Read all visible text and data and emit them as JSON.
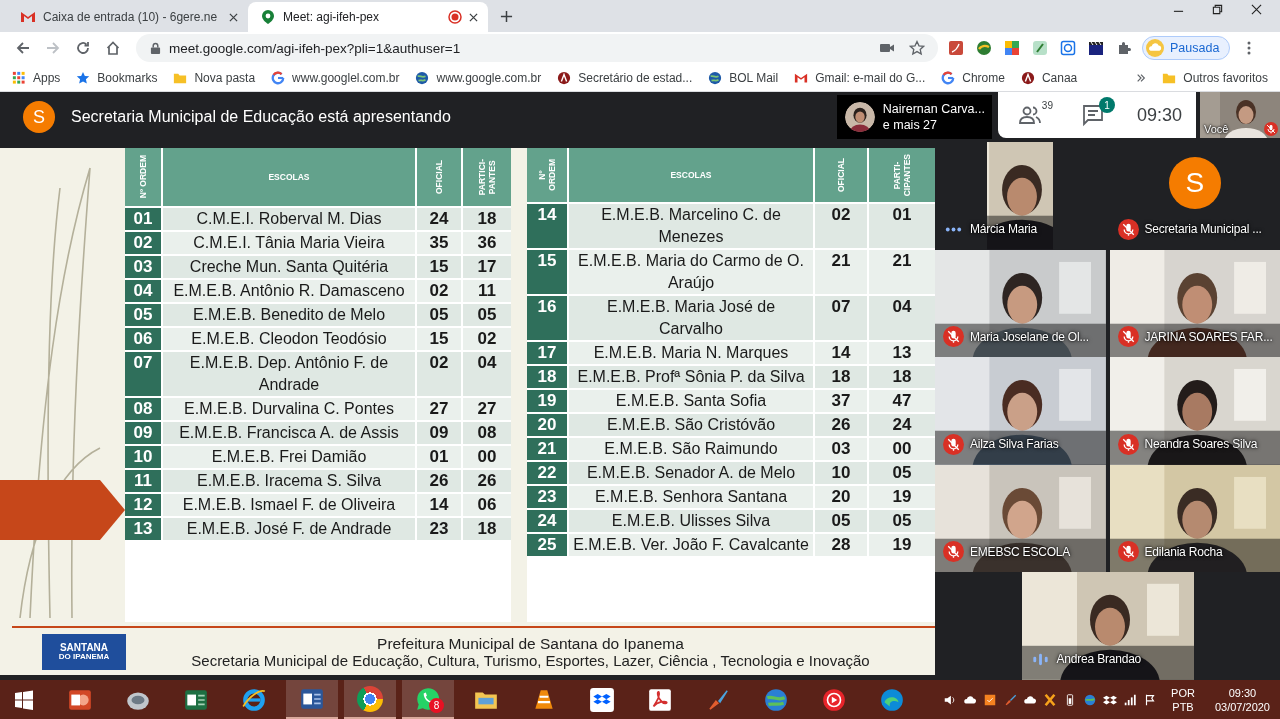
{
  "browser": {
    "tabs": [
      {
        "title": "Caixa de entrada (10) - 6gere.ne",
        "kind": "mail",
        "selected": false,
        "recording": false
      },
      {
        "title": "Meet: agi-ifeh-pex",
        "kind": "meet",
        "selected": true,
        "recording": true
      }
    ],
    "url": "meet.google.com/agi-ifeh-pex?pli=1&authuser=1",
    "profile_label": "Pausada",
    "bookmarks": [
      {
        "label": "Apps",
        "kind": "apps"
      },
      {
        "label": "Bookmarks",
        "kind": "star"
      },
      {
        "label": "Nova pasta",
        "kind": "folder"
      },
      {
        "label": "www.googlel.com.br",
        "kind": "google"
      },
      {
        "label": "www.google.com.br",
        "kind": "globe"
      },
      {
        "label": "Secretário de estad...",
        "kind": "seal"
      },
      {
        "label": "BOL Mail",
        "kind": "globe"
      },
      {
        "label": "Gmail: e-mail do G...",
        "kind": "mail"
      },
      {
        "label": "Chrome",
        "kind": "google"
      },
      {
        "label": "Canaa",
        "kind": "seal"
      }
    ],
    "other_bookmarks": "Outros favoritos"
  },
  "meet": {
    "presenter_initial": "S",
    "presenting_text": "Secretaria Municipal de Educação está apresentando",
    "preview_name": "Nairernan Carva...",
    "preview_more": "e mais 27",
    "people_count": "39",
    "chat_badge": "1",
    "time": "09:30",
    "self_label": "Você"
  },
  "slide": {
    "tables": [
      {
        "headers": [
          [
            "Nº ORDEM"
          ],
          [
            "ESCOLAS"
          ],
          [
            "OFICIAL"
          ],
          [
            "PARTICI-",
            "PANTES"
          ]
        ],
        "rows": [
          {
            "number": "01",
            "school": "C.M.E.I. Roberval M. Dias",
            "oficial": "24",
            "participantes": "18"
          },
          {
            "number": "02",
            "school": "C.M.E.I. Tânia Maria Vieira",
            "oficial": "35",
            "participantes": "36"
          },
          {
            "number": "03",
            "school": "Creche Mun. Santa Quitéria",
            "oficial": "15",
            "participantes": "17"
          },
          {
            "number": "04",
            "school": "E.M.E.B. Antônio R. Damasceno",
            "oficial": "02",
            "participantes": "11"
          },
          {
            "number": "05",
            "school": "E.M.E.B. Benedito de Melo",
            "oficial": "05",
            "participantes": "05"
          },
          {
            "number": "06",
            "school": "E.M.E.B. Cleodon Teodósio",
            "oficial": "15",
            "participantes": "02"
          },
          {
            "number": "07",
            "school": "E.M.E.B. Dep. Antônio F. de Andrade",
            "oficial": "02",
            "participantes": "04"
          },
          {
            "number": "08",
            "school": "E.M.E.B. Durvalina C. Pontes",
            "oficial": "27",
            "participantes": "27"
          },
          {
            "number": "09",
            "school": "E.M.E.B. Francisca A. de Assis",
            "oficial": "09",
            "participantes": "08"
          },
          {
            "number": "10",
            "school": "E.M.E.B. Frei Damião",
            "oficial": "01",
            "participantes": "00"
          },
          {
            "number": "11",
            "school": "E.M.E.B. Iracema S. Silva",
            "oficial": "26",
            "participantes": "26"
          },
          {
            "number": "12",
            "school": "E.M.E.B. Ismael F. de Oliveira",
            "oficial": "14",
            "participantes": "06"
          },
          {
            "number": "13",
            "school": "E.M.E.B. José F. de Andrade",
            "oficial": "23",
            "participantes": "18"
          }
        ]
      },
      {
        "headers": [
          [
            "Nº",
            "ORDEM"
          ],
          [
            "ESCOLAS"
          ],
          [
            "OFICIAL"
          ],
          [
            "PARTI-",
            "CIPANTES"
          ]
        ],
        "rows": [
          {
            "number": "14",
            "school": "E.M.E.B. Marcelino C. de Menezes",
            "oficial": "02",
            "participantes": "01"
          },
          {
            "number": "15",
            "school": "E.M.E.B. Maria do Carmo de O. Araújo",
            "oficial": "21",
            "participantes": "21"
          },
          {
            "number": "16",
            "school": "E.M.E.B. Maria José de Carvalho",
            "oficial": "07",
            "participantes": "04"
          },
          {
            "number": "17",
            "school": "E.M.E.B. Maria N. Marques",
            "oficial": "14",
            "participantes": "13"
          },
          {
            "number": "18",
            "school": "E.M.E.B. Profª Sônia P. da Silva",
            "oficial": "18",
            "participantes": "18"
          },
          {
            "number": "19",
            "school": "E.M.E.B. Santa Sofia",
            "oficial": "37",
            "participantes": "47"
          },
          {
            "number": "20",
            "school": "E.M.E.B. São Cristóvão",
            "oficial": "26",
            "participantes": "24"
          },
          {
            "number": "21",
            "school": "E.M.E.B. São Raimundo",
            "oficial": "03",
            "participantes": "00"
          },
          {
            "number": "22",
            "school": "E.M.E.B. Senador A. de Melo",
            "oficial": "10",
            "participantes": "05"
          },
          {
            "number": "23",
            "school": "E.M.E.B. Senhora Santana",
            "oficial": "20",
            "participantes": "19"
          },
          {
            "number": "24",
            "school": "E.M.E.B. Ulisses Silva",
            "oficial": "05",
            "participantes": "05"
          },
          {
            "number": "25",
            "school": "E.M.E.B. Ver. João F. Cavalcante",
            "oficial": "28",
            "participantes": "19"
          }
        ]
      }
    ],
    "logo_lines": [
      "SANTANA",
      "DO IPANEMA"
    ],
    "footer": [
      "Prefeitura Municipal de Santana do Ipanema",
      "Secretaria Municipal de Educação, Cultura, Turismo, Esportes, Lazer, Ciência , Tecnologia e Inovação"
    ]
  },
  "tiles": [
    {
      "name": "Márcia Maria",
      "kind": "narrow",
      "muted": false,
      "speaking": false
    },
    {
      "name": "Secretaria Municipal ...",
      "kind": "avatar",
      "initial": "S",
      "muted": true
    },
    {
      "name": "Maria Joselane de Ol...",
      "kind": "video",
      "muted": true
    },
    {
      "name": "JARINA SOARES FAR...",
      "kind": "video",
      "muted": true
    },
    {
      "name": "Ailza Silva Farias",
      "kind": "video",
      "muted": true
    },
    {
      "name": "Neandra Soares Silva",
      "kind": "video",
      "muted": true
    },
    {
      "name": "EMEBSC ESCOLA",
      "kind": "video",
      "muted": true
    },
    {
      "name": "Edilania Rocha",
      "kind": "video",
      "muted": true
    },
    {
      "name": "Andrea Brandao",
      "kind": "video",
      "muted": false,
      "speaking": true
    }
  ],
  "taskbar": {
    "apps": [
      {
        "kind": "slides",
        "active": false
      },
      {
        "kind": "disk",
        "active": false
      },
      {
        "kind": "sheet",
        "active": false
      },
      {
        "kind": "ie",
        "active": false
      },
      {
        "kind": "doc",
        "active": true
      },
      {
        "kind": "chrome",
        "active": true
      },
      {
        "kind": "whatsapp",
        "active": true,
        "badge": "8"
      },
      {
        "kind": "folder",
        "active": false
      },
      {
        "kind": "cone",
        "active": false
      },
      {
        "kind": "dropbox",
        "active": false
      },
      {
        "kind": "pdf",
        "active": false
      },
      {
        "kind": "brush",
        "active": false
      },
      {
        "kind": "globe",
        "active": false
      },
      {
        "kind": "play",
        "active": false
      },
      {
        "kind": "edge",
        "active": false
      }
    ],
    "lang": "POR",
    "layout": "PTB",
    "time": "09:30",
    "date": "03/07/2020"
  }
}
